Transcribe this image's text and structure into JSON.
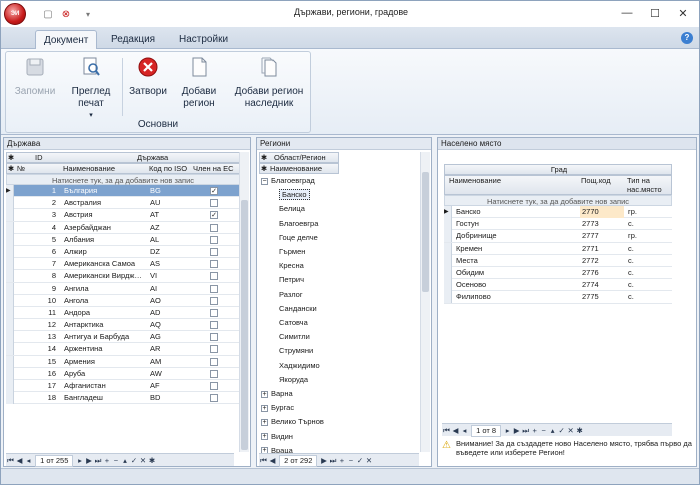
{
  "window": {
    "title": "Държави, региони, градове",
    "app_badge": "ЭИ"
  },
  "ribbon": {
    "tabs": [
      "Документ",
      "Редакция",
      "Настройки"
    ],
    "active_tab": "Документ",
    "group_label": "Основни",
    "buttons": {
      "save": "Запомни",
      "preview": "Преглед печат",
      "close": "Затвори",
      "add_region": "Добави регион",
      "add_region_child": "Добави регион наследник"
    }
  },
  "countries": {
    "panel_title": "Държава",
    "col_id": "ID",
    "col_country": "Държава",
    "col_no": "№",
    "col_name": "Наименование",
    "col_iso": "Код по ISO",
    "col_eu": "Член на ЕС",
    "new_row": "Натиснете тук, за да добавите нов запис",
    "rows": [
      {
        "no": "1",
        "name": "България",
        "iso": "BG",
        "eu": true
      },
      {
        "no": "2",
        "name": "Австралия",
        "iso": "AU",
        "eu": false
      },
      {
        "no": "3",
        "name": "Австрия",
        "iso": "AT",
        "eu": true
      },
      {
        "no": "4",
        "name": "Азербайджан",
        "iso": "AZ",
        "eu": false
      },
      {
        "no": "5",
        "name": "Албания",
        "iso": "AL",
        "eu": false
      },
      {
        "no": "6",
        "name": "Алжир",
        "iso": "DZ",
        "eu": false
      },
      {
        "no": "7",
        "name": "Американска Самоа",
        "iso": "AS",
        "eu": false
      },
      {
        "no": "8",
        "name": "Американски Вирдж…",
        "iso": "VI",
        "eu": false
      },
      {
        "no": "9",
        "name": "Ангила",
        "iso": "AI",
        "eu": false
      },
      {
        "no": "10",
        "name": "Ангола",
        "iso": "AO",
        "eu": false
      },
      {
        "no": "11",
        "name": "Андора",
        "iso": "AD",
        "eu": false
      },
      {
        "no": "12",
        "name": "Антарктика",
        "iso": "AQ",
        "eu": false
      },
      {
        "no": "13",
        "name": "Антигуа и Барбуда",
        "iso": "AG",
        "eu": false
      },
      {
        "no": "14",
        "name": "Аржентина",
        "iso": "AR",
        "eu": false
      },
      {
        "no": "15",
        "name": "Армения",
        "iso": "AM",
        "eu": false
      },
      {
        "no": "16",
        "name": "Аруба",
        "iso": "AW",
        "eu": false
      },
      {
        "no": "17",
        "name": "Афганистан",
        "iso": "AF",
        "eu": false
      },
      {
        "no": "18",
        "name": "Бангладеш",
        "iso": "BD",
        "eu": false
      }
    ],
    "pager": "1 от 255"
  },
  "regions": {
    "panel_title": "Региони",
    "col_region": "Област/Регион",
    "col_name": "Наименование",
    "expanded": "Благоевград",
    "children": [
      "Банско",
      "Белица",
      "Благоевгра",
      "Гоце делче",
      "Гърмен",
      "Кресна",
      "Петрич",
      "Разлог",
      "Сандански",
      "Сатовча",
      "Симитли",
      "Струмяни",
      "Хаджидимо",
      "Якоруда"
    ],
    "selected_child": "Банско",
    "collapsed": [
      "Варна",
      "Бургас",
      "Велико Търнов",
      "Видин",
      "Враца"
    ],
    "pager": "2 от 292"
  },
  "places": {
    "panel_title": "Населено място",
    "col_city": "Град",
    "col_name": "Наименование",
    "col_zip": "Пощ.код",
    "col_type": "Тип на нас.място",
    "new_row": "Натиснете тук, за да добавите нов запис",
    "rows": [
      {
        "name": "Банско",
        "zip": "2770",
        "type": "гр."
      },
      {
        "name": "Гостун",
        "zip": "2773",
        "type": "с."
      },
      {
        "name": "Добринище",
        "zip": "2777",
        "type": "гр."
      },
      {
        "name": "Кремен",
        "zip": "2771",
        "type": "с."
      },
      {
        "name": "Места",
        "zip": "2772",
        "type": "с."
      },
      {
        "name": "Обидим",
        "zip": "2776",
        "type": "с."
      },
      {
        "name": "Осеново",
        "zip": "2774",
        "type": "с."
      },
      {
        "name": "Филипово",
        "zip": "2775",
        "type": "с."
      }
    ],
    "pager": "1 от 8",
    "warning": "Внимание! За да създадете ново Населено място, трябва първо да въведете или изберете Регион!"
  }
}
